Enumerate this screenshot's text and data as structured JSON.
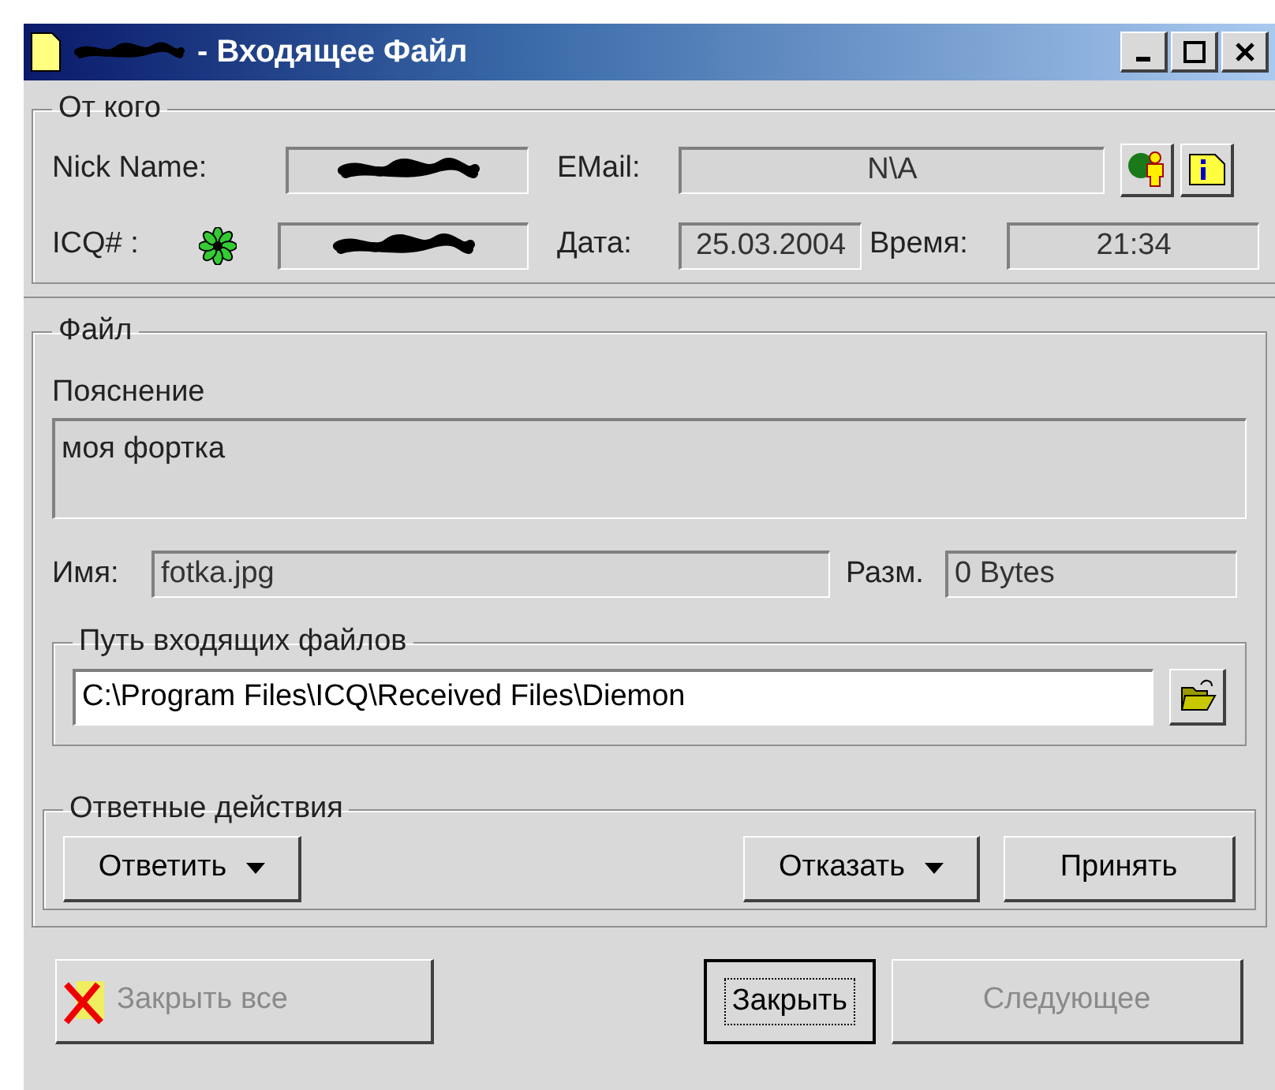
{
  "window": {
    "title_redacted": true,
    "title": "- Входящее Файл"
  },
  "sender": {
    "legend": "От кого",
    "nick_label": "Nick Name:",
    "nick_field": {
      "kind": "redacted"
    },
    "email_label": "EMail:",
    "email_field": {
      "kind": "text",
      "value": "N\\A"
    },
    "icq_label": "ICQ# :",
    "icq_field": {
      "kind": "redacted"
    },
    "date_label": "Дата:",
    "date_field": {
      "kind": "text",
      "value": "25.03.2004"
    },
    "time_label": "Время:",
    "time_field": {
      "kind": "text",
      "value": "21:34"
    }
  },
  "file": {
    "legend": "Файл",
    "description_label": "Пояснение",
    "description": "моя фортка",
    "name_label": "Имя:",
    "name": "fotka.jpg",
    "size_label": "Разм.",
    "size": "0 Bytes",
    "path_legend": "Путь входящих файлов",
    "path": "C:\\Program Files\\ICQ\\Received Files\\Diemon",
    "actions_legend": "Ответные действия",
    "actions": [
      {
        "label": "Ответить",
        "dropdown": true
      },
      {
        "label": "Отказать",
        "dropdown": true
      },
      {
        "label": "Принять",
        "dropdown": false
      }
    ]
  },
  "buttons": [
    {
      "label": "Закрыть все",
      "disabled": true,
      "default": false,
      "icon": true
    },
    {
      "label": "Закрыть",
      "disabled": false,
      "default": true,
      "icon": false
    },
    {
      "label": "Следующее",
      "disabled": true,
      "default": false,
      "icon": false
    }
  ]
}
